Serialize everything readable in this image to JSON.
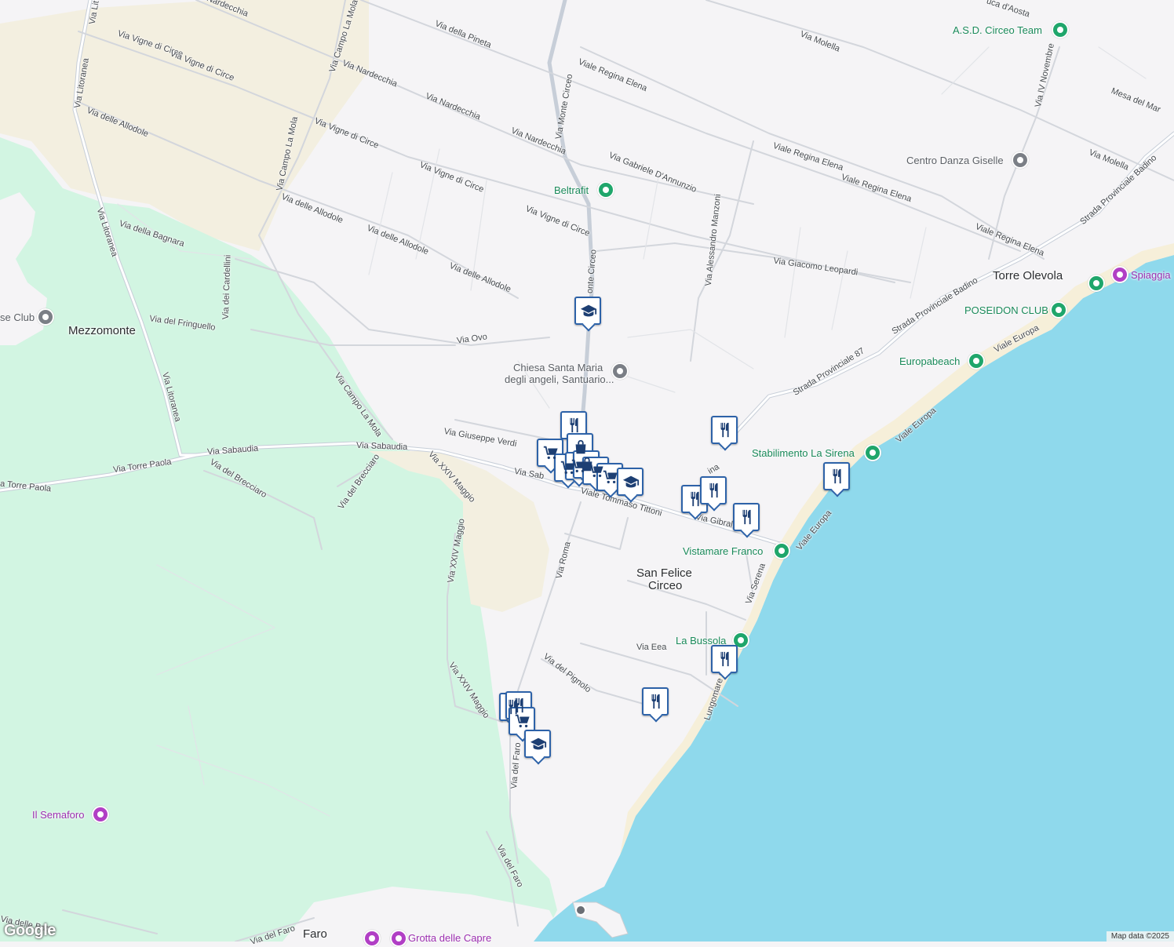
{
  "map": {
    "attribution": "Map data ©2025",
    "logo": "Google",
    "colors": {
      "land": "#f5f4f6",
      "park": "#d2f5e2",
      "sand": "#f6efd9",
      "water": "#8fd9ec",
      "road": "#ffffff",
      "marker_border": "#2d62a8",
      "poi_green": "#1a8a5a"
    }
  },
  "places": [
    {
      "text": "Mezzomonte"
    },
    {
      "text": "San Felice"
    },
    {
      "text": "Circeo"
    },
    {
      "text": "Torre Olevola"
    },
    {
      "text": "Faro"
    }
  ],
  "streets": [
    {
      "text": "Nardecchia"
    },
    {
      "text": "Via della Pineta"
    },
    {
      "text": "Via Molella"
    },
    {
      "text": "Via Vigne di Circe"
    },
    {
      "text": "Via Vigne di Circe"
    },
    {
      "text": "Via Nardecchia"
    },
    {
      "text": "Via Nardecchia"
    },
    {
      "text": "Via Nardecchia"
    },
    {
      "text": "Viale Regina Elena"
    },
    {
      "text": "Via delle Allodole"
    },
    {
      "text": "Via Litoranea"
    },
    {
      "text": "Via Litoranea"
    },
    {
      "text": "Via Lit"
    },
    {
      "text": "Via Campo La Mola"
    },
    {
      "text": "Via Campo La Mola"
    },
    {
      "text": "Via Vigne di Circe"
    },
    {
      "text": "Via Vigne di Circe"
    },
    {
      "text": "Via Vigne di Circe"
    },
    {
      "text": "Via Monte Circeo"
    },
    {
      "text": "Via Gabriele D'Annunzio"
    },
    {
      "text": "Viale Regina Elena"
    },
    {
      "text": "Viale Regina Elena"
    },
    {
      "text": "Viale Regina Elena"
    },
    {
      "text": "Via Molella"
    },
    {
      "text": "Via delle Allodole"
    },
    {
      "text": "Via delle Allodole"
    },
    {
      "text": "Via delle Allodole"
    },
    {
      "text": "Via della Bagnara"
    },
    {
      "text": "Via dei Cardellini"
    },
    {
      "text": "Via del Fringuello"
    },
    {
      "text": "Via Ovo"
    },
    {
      "text": "onte Circeo"
    },
    {
      "text": "Via Alessandro Manzoni"
    },
    {
      "text": "Via Giacomo Leopardi"
    },
    {
      "text": "Strada Provinciale 87"
    },
    {
      "text": "Strada Provinciale Badino"
    },
    {
      "text": "Strada Provinciale Badino"
    },
    {
      "text": "Via Campo La Mola"
    },
    {
      "text": "Via Giuseppe Verdi"
    },
    {
      "text": "Via Sabaudia"
    },
    {
      "text": "Via Sabaudia"
    },
    {
      "text": "Via Sab"
    },
    {
      "text": "Via Torre Paola"
    },
    {
      "text": "a Torre Paola"
    },
    {
      "text": "Via del Brecciaro"
    },
    {
      "text": "Via del Brecciaro"
    },
    {
      "text": "Via XXIV Maggio"
    },
    {
      "text": "Via XXIV Maggio"
    },
    {
      "text": "Via XXIV Maggio"
    },
    {
      "text": "Viale Tommaso Tittoni"
    },
    {
      "text": "Via Gibral"
    },
    {
      "text": "ina"
    },
    {
      "text": "Via Roma"
    },
    {
      "text": "Via Serena"
    },
    {
      "text": "Viale Europa"
    },
    {
      "text": "Viale Europa"
    },
    {
      "text": "Viale Europa"
    },
    {
      "text": "Via Eea"
    },
    {
      "text": "Via del Pignolo"
    },
    {
      "text": "Lungomare C"
    },
    {
      "text": "Via del Faro"
    },
    {
      "text": "Via del Faro"
    },
    {
      "text": "Via del Faro"
    },
    {
      "text": "Via delle Batt"
    },
    {
      "text": "Via IV Novembre"
    },
    {
      "text": "Mesa del Mar"
    },
    {
      "text": "uca d'Aosta"
    },
    {
      "text": "Via Litoranea"
    }
  ],
  "pois": [
    {
      "text": "A.S.D. Circeo Team",
      "icon": "pin-dot-icon",
      "color": "green"
    },
    {
      "text": "Beltrafit",
      "icon": "pin-dot-icon",
      "color": "green"
    },
    {
      "text": "Centro Danza Giselle",
      "icon": "pin-dot-icon",
      "color": "grey"
    },
    {
      "text": "POSEIDON CLUB",
      "icon": "pin-dot-icon",
      "color": "green"
    },
    {
      "text": "Europabeach",
      "icon": "pin-dot-icon",
      "color": "green"
    },
    {
      "text": "Stabilimento La Sirena",
      "icon": "pin-dot-icon",
      "color": "green"
    },
    {
      "text": "Vistamare Franco",
      "icon": "pin-dot-icon",
      "color": "green"
    },
    {
      "text": "La Bussola",
      "icon": "pin-dot-icon",
      "color": "green"
    },
    {
      "text": "se Club",
      "icon": "pin-dot-icon",
      "color": "grey"
    },
    {
      "text": "Chiesa Santa Maria",
      "icon": "church-icon",
      "color": "grey"
    },
    {
      "text": "degli angeli, Santuario...",
      "icon": "church-icon",
      "color": "grey"
    },
    {
      "text": "Spiaggia",
      "icon": "camera-icon",
      "color": "purple"
    },
    {
      "text": "Il Semaforo",
      "icon": "camera-icon",
      "color": "purple"
    },
    {
      "text": "Grotta delle Capre",
      "icon": "camera-icon",
      "color": "purple"
    }
  ],
  "markers": [
    {
      "type": "school-icon"
    },
    {
      "type": "restaurant-icon"
    },
    {
      "type": "restaurant-icon"
    },
    {
      "type": "shopping-cart-icon"
    },
    {
      "type": "shopping-bag-icon"
    },
    {
      "type": "shopping-cart-icon"
    },
    {
      "type": "shopping-cart-icon"
    },
    {
      "type": "shopping-bag-icon"
    },
    {
      "type": "shopping-cart-icon"
    },
    {
      "type": "shopping-cart-icon"
    },
    {
      "type": "school-icon"
    },
    {
      "type": "restaurant-icon"
    },
    {
      "type": "restaurant-icon"
    },
    {
      "type": "restaurant-icon"
    },
    {
      "type": "restaurant-icon"
    },
    {
      "type": "restaurant-icon"
    },
    {
      "type": "restaurant-icon"
    },
    {
      "type": "restaurant-icon"
    },
    {
      "type": "restaurant-icon"
    },
    {
      "type": "shopping-cart-icon"
    },
    {
      "type": "school-icon"
    }
  ]
}
